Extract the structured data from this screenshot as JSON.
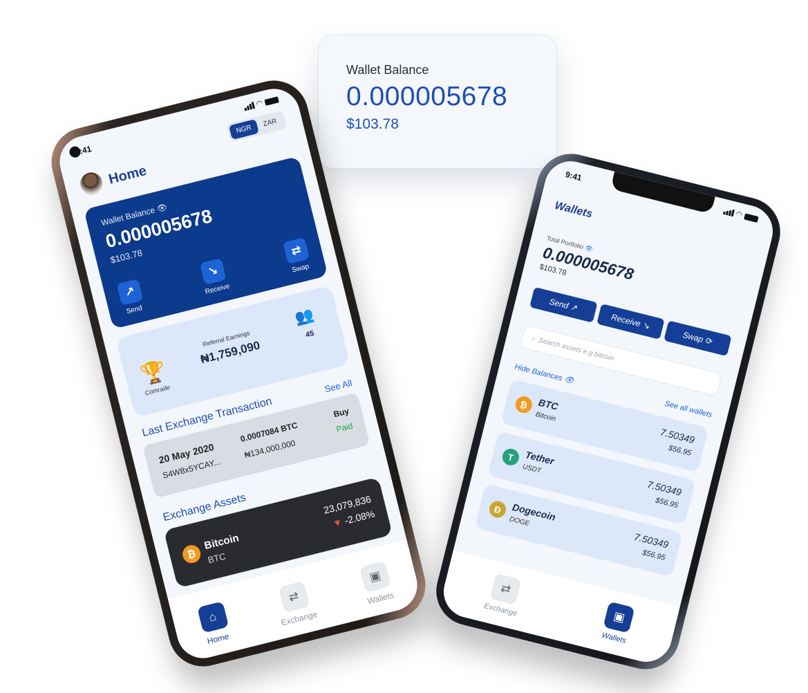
{
  "floating_card": {
    "label": "Wallet Balance",
    "amount": "0.000005678",
    "fiat": "$103.78"
  },
  "left_phone": {
    "status_time": "9:41",
    "title": "Home",
    "currency_options": [
      "NGR",
      "ZAR"
    ],
    "selected_currency": "NGR",
    "balance_card": {
      "label": "Wallet Balance",
      "amount": "0.000005678",
      "fiat": "$103.78",
      "actions": [
        {
          "label": "Send",
          "icon": "arrow-up-right-icon"
        },
        {
          "label": "Receive",
          "icon": "arrow-down-right-icon"
        },
        {
          "label": "Swap",
          "icon": "swap-arrows-icon"
        }
      ]
    },
    "referral": {
      "trophy_label": "Comrade",
      "earnings_label": "Referral Earnings",
      "earnings_amount": "₦1,759,090",
      "referral_count": "45"
    },
    "last_exchange": {
      "title": "Last Exchange Transaction",
      "see_all": "See All",
      "transaction": {
        "date": "20 May 2020",
        "id": "S4W8x5YCAY...",
        "btc_amount": "0.0007084 BTC",
        "naira_amount": "₦134,000,000",
        "type": "Buy",
        "status": "Paid"
      }
    },
    "exchange_assets": {
      "title": "Exchange Assets",
      "asset": {
        "name": "Bitcoin",
        "symbol": "BTC",
        "price": "23,079,836",
        "change": "-2.08%"
      }
    },
    "tabs": [
      {
        "label": "Home",
        "icon": "home-icon",
        "active": true
      },
      {
        "label": "Exchange",
        "icon": "exchange-icon",
        "active": false
      },
      {
        "label": "Wallets",
        "icon": "wallet-icon",
        "active": false
      }
    ]
  },
  "right_phone": {
    "status_time": "9:41",
    "title": "Wallets",
    "portfolio_label": "Total Portfolio",
    "portfolio_amount": "0.000005678",
    "portfolio_fiat": "$103.78",
    "actions": [
      "Send",
      "Receive",
      "Swap"
    ],
    "search_placeholder": "Search assets e.g bitcoin",
    "hide_balances": "Hide Balances",
    "see_all_wallets": "See all wallets",
    "wallets": [
      {
        "name": "BTC",
        "sub": "Bitcoin",
        "amount": "7.50349",
        "fiat": "$56.95",
        "color": "#f29a1f",
        "glyph": "₿"
      },
      {
        "name": "Tether",
        "sub": "USDT",
        "amount": "7.50349",
        "fiat": "$56.95",
        "color": "#26a17b",
        "glyph": "T"
      },
      {
        "name": "Dogecoin",
        "sub": "DOGE",
        "amount": "7.50349",
        "fiat": "$56.95",
        "color": "#c8a632",
        "glyph": "Ð"
      }
    ],
    "tabs": [
      {
        "label": "Exchange",
        "icon": "exchange-icon",
        "active": false
      },
      {
        "label": "Wallets",
        "icon": "wallet-icon",
        "active": true
      }
    ]
  }
}
